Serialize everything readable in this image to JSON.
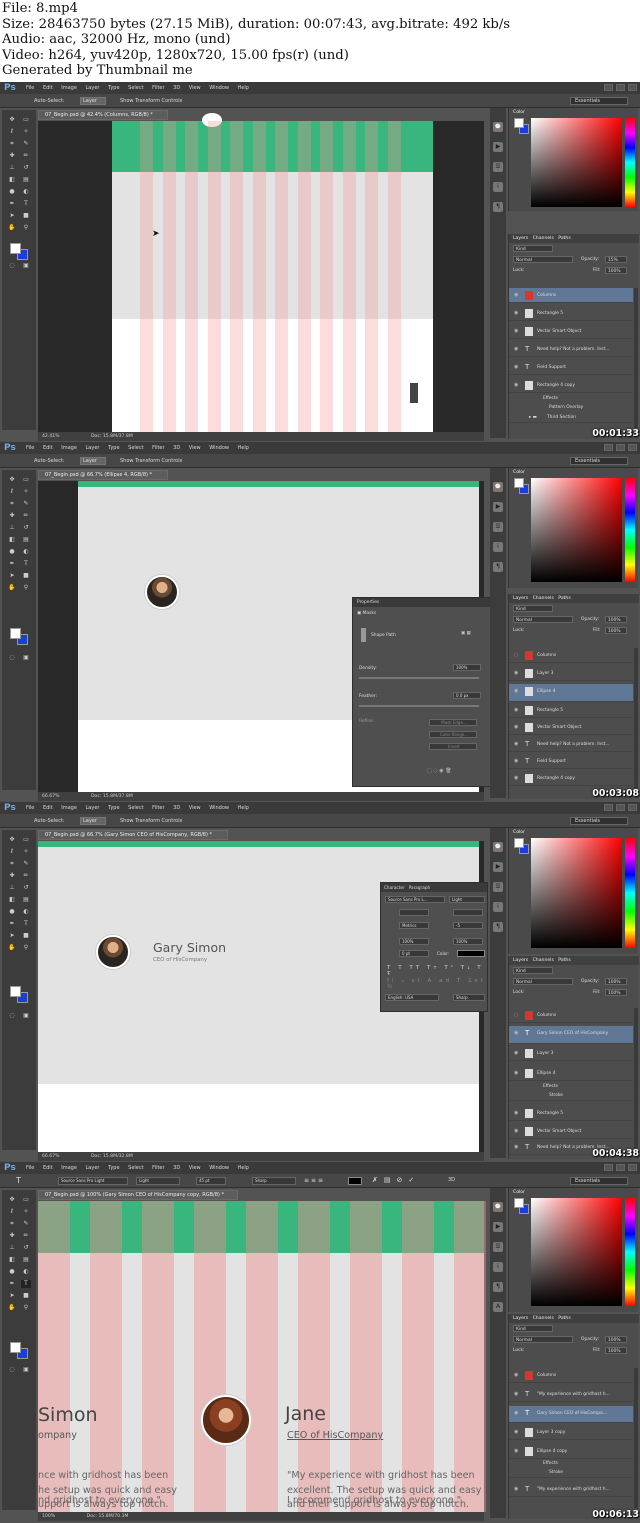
{
  "header": {
    "lines": [
      "File: 8.mp4",
      "Size: 28463750 bytes (27.15 MiB), duration: 00:07:43, avg.bitrate: 492 kb/s",
      "Audio: aac, 32000 Hz, mono (und)",
      "Video: h264, yuv420p, 1280x720, 15.00 fps(r) (und)",
      "Generated by Thumbnail me"
    ]
  },
  "app": {
    "logo": "Ps",
    "menus": [
      "File",
      "Edit",
      "Image",
      "Layer",
      "Type",
      "Select",
      "Filter",
      "3D",
      "View",
      "Window",
      "Help"
    ],
    "workspace": "Essentials",
    "auto_select": "Auto-Select:",
    "auto_select_value": "Layer",
    "show_transform": "Show Transform Controls",
    "mode_label": "3D Mode:",
    "color_tab": "Color",
    "layers_tabs": [
      "Layers",
      "Channels",
      "Paths"
    ],
    "kind": "Kind",
    "blend": "Normal",
    "opacity_label": "Opacity:",
    "fill_label": "Fill:",
    "lock_label": "Lock:",
    "colors": {
      "green": "#39b57e",
      "pink": "#f2c4c4",
      "canvas_gray": "#e3e3e3",
      "selection": "#607896",
      "bg_swatch": "#1b3fd6"
    }
  },
  "frames": [
    {
      "timestamp": "00:01:33",
      "doc_tab": "07_Begin.psd @ 42.4% (Columns, RGB/8) *",
      "zoom": "42.41%",
      "doc_size": "Doc: 15.8M/37.8M",
      "opacity": "15%",
      "fill": "100%",
      "layers": [
        "Columns",
        "Rectangle 5",
        "Vector Smart Object",
        "Need help? Not a problem. Inst...",
        "Field Support",
        "Rectangle 4 copy",
        "Effects",
        "Pattern Overlay",
        "Third Section"
      ]
    },
    {
      "timestamp": "00:03:08",
      "doc_tab": "07_Begin.psd @ 66.7% (Ellipse 4, RGB/8) *",
      "zoom": "66.67%",
      "doc_size": "Doc: 15.8M/37.8M",
      "opacity": "100%",
      "fill": "100%",
      "layers": [
        "Columns",
        "Layer 3",
        "Ellipse 4",
        "Rectangle 5",
        "Vector Smart Object",
        "Need help? Not a problem. Inst...",
        "Field Support",
        "Rectangle 4 copy"
      ],
      "properties": {
        "title": "Properties",
        "section": "Masks",
        "shape_path": "Shape Path",
        "density_label": "Density:",
        "density": "100%",
        "feather_label": "Feather:",
        "feather": "0.0 px",
        "refine_label": "Refine:",
        "buttons": [
          "Mask Edge...",
          "Color Range...",
          "Invert"
        ]
      }
    },
    {
      "timestamp": "00:04:38",
      "doc_tab": "07_Begin.psd @ 66.7% (Gary Simon CEO of HisCompany, RGB/8) *",
      "zoom": "66.67%",
      "doc_size": "Doc: 15.8M/32.8M",
      "opacity": "100%",
      "fill": "100%",
      "name": "Gary Simon",
      "subtitle": "CEO of HisCompany",
      "layers": [
        "Columns",
        "Gary Simon CEO of HisCompany",
        "Layer 3",
        "Ellipse 4",
        "Effects",
        "Stroke",
        "Rectangle 5",
        "Vector Smart Object",
        "Need help? Not a problem. Inst..."
      ],
      "character": {
        "tabs": [
          "Character",
          "Paragraph"
        ],
        "font": "Source Sans Pro L...",
        "style": "Light",
        "tracking_mode": "Metrics",
        "tracking": "-5",
        "scale_v": "100%",
        "scale_h": "100%",
        "baseline": "0 pt",
        "color_label": "Color:",
        "language": "English: USA",
        "antialias": "Sharp"
      }
    },
    {
      "timestamp": "00:06:13",
      "doc_tab": "07_Begin.psd @ 100% (Gary Simon CEO of HisCompany copy, RGB/8) *",
      "zoom": "100%",
      "doc_size": "Doc: 15.8M/70.3M",
      "opacity": "100%",
      "fill": "100%",
      "font": "Source Sans Pro Light",
      "style": "Light",
      "size": "45 pt",
      "aa": "Sharp",
      "left_name": "Simon",
      "left_company": "ompany",
      "left_quote": [
        "nce with gridhost has been",
        "he setup was quick and easy",
        "upport is always top notch."
      ],
      "left_rec": "nd gridhost to everyone.\"",
      "right_name": "Jane",
      "right_company": "CEO of HisCompany",
      "right_quote": [
        "\"My experience with gridhost has been",
        "excellent. The setup was quick and easy",
        "and their support is always top notch."
      ],
      "right_rec": "I recommend gridhost to everyone.\"",
      "layers": [
        "Columns",
        "\"My experience with gridhost h...",
        "Gary Simon CEO of HisCompa...",
        "Layer 3 copy",
        "Ellipse 4 copy",
        "Effects",
        "Stroke",
        "\"My experience with gridhost h..."
      ]
    }
  ]
}
